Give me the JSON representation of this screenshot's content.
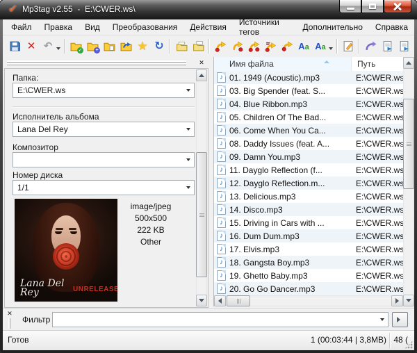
{
  "window": {
    "title": "Mp3tag v2.55  -  E:\\CWER.ws\\"
  },
  "menu": {
    "items": [
      "Файл",
      "Правка",
      "Вид",
      "Преобразования",
      "Действия",
      "Источники тегов",
      "Дополнительно",
      "Справка"
    ]
  },
  "toolbar": {
    "icons": [
      "save",
      "remove-tag",
      "undo",
      "undo-dropdown",
      "folder-check",
      "folder-add",
      "folder-export",
      "folder-refresh",
      "favorites-star",
      "refresh",
      "tag-copy",
      "tag-paste",
      "convert-tag-to-filename",
      "convert-filename-to-tag",
      "convert-filename-to-filename",
      "convert-tag-to-tag",
      "convert-text-file-to-tag",
      "case-conversion",
      "actions",
      "edit-tag",
      "web-sources",
      "playlist-export",
      "playlist-export-all"
    ]
  },
  "tag_panel": {
    "folder": {
      "label": "Папка:",
      "value": "E:\\CWER.ws"
    },
    "album_artist": {
      "label": "Исполнитель альбома",
      "value": "Lana Del Rey"
    },
    "composer": {
      "label": "Композитор",
      "value": ""
    },
    "disc_number": {
      "label": "Номер диска",
      "value": "1/1"
    },
    "cover": {
      "mime": "image/jpeg",
      "dimensions": "500x500",
      "size": "222 KB",
      "kind": "Other",
      "art_artist": "Lana Del Rey",
      "art_title": "UNRELEASED"
    }
  },
  "file_list": {
    "columns": [
      {
        "label": "Имя файла",
        "sorted": "asc"
      },
      {
        "label": "Путь"
      }
    ],
    "rows": [
      {
        "name": "01. 1949 (Acoustic).mp3",
        "path": "E:\\CWER.ws\\"
      },
      {
        "name": "03. Big Spender (feat. S...",
        "path": "E:\\CWER.ws\\"
      },
      {
        "name": "04. Blue Ribbon.mp3",
        "path": "E:\\CWER.ws\\"
      },
      {
        "name": "05. Children Of The Bad...",
        "path": "E:\\CWER.ws\\"
      },
      {
        "name": "06. Come When You Ca...",
        "path": "E:\\CWER.ws\\"
      },
      {
        "name": "08. Daddy Issues (feat. A...",
        "path": "E:\\CWER.ws\\"
      },
      {
        "name": "09. Damn You.mp3",
        "path": "E:\\CWER.ws\\"
      },
      {
        "name": "11. Dayglo Reflection (f...",
        "path": "E:\\CWER.ws\\"
      },
      {
        "name": "12. Dayglo Reflection.m...",
        "path": "E:\\CWER.ws\\"
      },
      {
        "name": "13. Delicious.mp3",
        "path": "E:\\CWER.ws\\"
      },
      {
        "name": "14. Disco.mp3",
        "path": "E:\\CWER.ws\\"
      },
      {
        "name": "15. Driving in Cars with ...",
        "path": "E:\\CWER.ws\\"
      },
      {
        "name": "16. Dum Dum.mp3",
        "path": "E:\\CWER.ws\\"
      },
      {
        "name": "17. Elvis.mp3",
        "path": "E:\\CWER.ws\\"
      },
      {
        "name": "18. Gangsta Boy.mp3",
        "path": "E:\\CWER.ws\\"
      },
      {
        "name": "19. Ghetto Baby.mp3",
        "path": "E:\\CWER.ws\\"
      },
      {
        "name": "20. Go Go Dancer.mp3",
        "path": "E:\\CWER.ws\\"
      }
    ]
  },
  "filter": {
    "label": "Фильтр",
    "value": ""
  },
  "status_bar": {
    "ready": "Готов",
    "selection_info": "1 (00:03:44 | 3,8MB)",
    "count": "48 ("
  },
  "colors": {
    "titlebar_dark": "#2e2e2e",
    "close_button_red": "#b02b12",
    "folder_yellow": "#fbce3e",
    "note_blue": "#1f74bd",
    "sorted_column_tint": "#f0f7fd",
    "cover_title_red": "#bf3526"
  }
}
